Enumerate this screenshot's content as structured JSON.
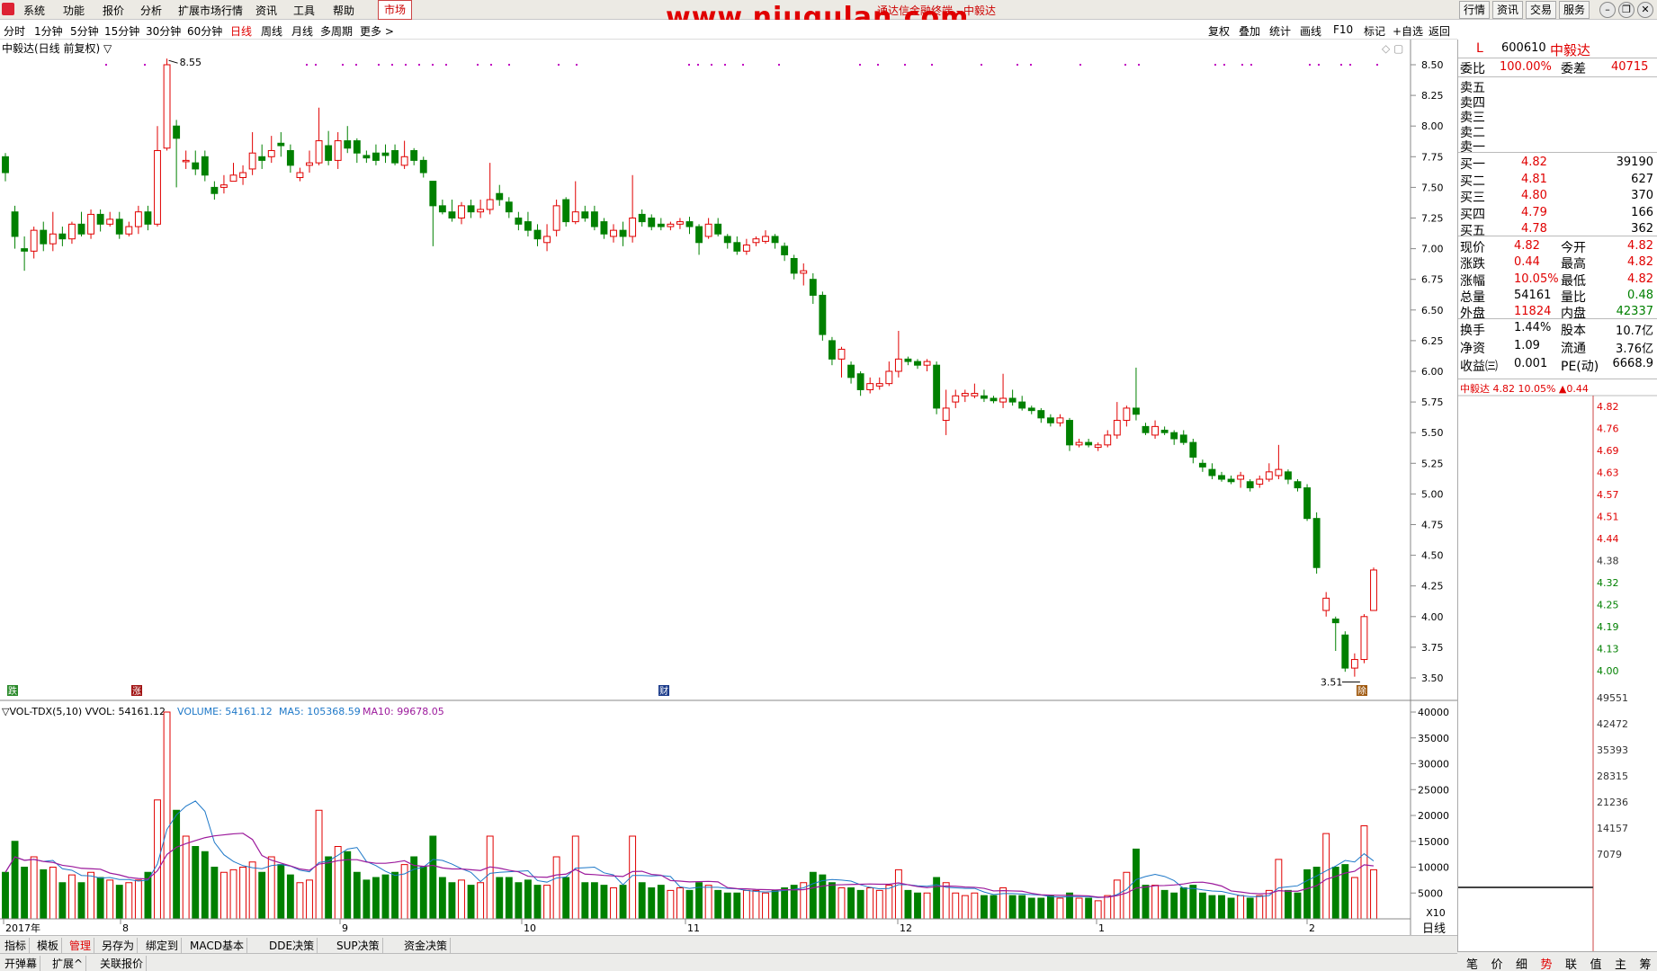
{
  "menu": {
    "items": [
      "系统",
      "功能",
      "报价",
      "分析",
      "扩展市场行情",
      "资讯",
      "工具",
      "帮助"
    ],
    "market_tab": "市场",
    "title": "通达信金融终端 - 中毅达",
    "right_buttons": [
      "行情",
      "资讯",
      "交易",
      "服务"
    ]
  },
  "watermark": "www.niugulan.com",
  "periods": [
    "分时",
    "1分钟",
    "5分钟",
    "15分钟",
    "30分钟",
    "60分钟",
    "日线",
    "周线",
    "月线",
    "多周期",
    "更多 >"
  ],
  "toolbar": [
    "复权",
    "叠加",
    "统计",
    "画线",
    "F10",
    "标记",
    "+自选",
    "返回"
  ],
  "chart_title": "中毅达(日线 前复权) ▽",
  "chart_data": {
    "type": "candlestick",
    "y_ticks": [
      "8.50",
      "8.25",
      "8.00",
      "7.75",
      "7.50",
      "7.25",
      "7.00",
      "6.75",
      "6.50",
      "6.25",
      "6.00",
      "5.75",
      "5.50",
      "5.25",
      "5.00",
      "4.75",
      "4.50",
      "4.25",
      "4.00",
      "3.75",
      "3.50"
    ],
    "high_label": "8.55",
    "low_label": "3.51",
    "x_labels": [
      "2017年",
      "8",
      "9",
      "10",
      "11",
      "12",
      "1",
      "2"
    ],
    "markers": [
      "跌",
      "涨",
      "财",
      "除"
    ],
    "candles": [
      [
        7.75,
        7.62,
        7.78,
        7.55
      ],
      [
        7.3,
        7.1,
        7.35,
        7.0
      ],
      [
        7.0,
        6.98,
        7.1,
        6.82
      ],
      [
        6.98,
        7.15,
        7.18,
        6.92
      ],
      [
        7.15,
        7.04,
        7.22,
        6.98
      ],
      [
        7.04,
        7.12,
        7.3,
        6.98
      ],
      [
        7.12,
        7.08,
        7.18,
        7.02
      ],
      [
        7.08,
        7.2,
        7.22,
        7.04
      ],
      [
        7.2,
        7.12,
        7.3,
        7.1
      ],
      [
        7.12,
        7.28,
        7.32,
        7.08
      ],
      [
        7.28,
        7.2,
        7.32,
        7.14
      ],
      [
        7.2,
        7.24,
        7.3,
        7.18
      ],
      [
        7.24,
        7.12,
        7.3,
        7.08
      ],
      [
        7.12,
        7.18,
        7.22,
        7.1
      ],
      [
        7.18,
        7.3,
        7.35,
        7.12
      ],
      [
        7.3,
        7.2,
        7.35,
        7.15
      ],
      [
        7.2,
        7.8,
        8.0,
        7.18
      ],
      [
        7.82,
        8.5,
        8.55,
        7.8
      ],
      [
        8.0,
        7.9,
        8.05,
        7.5
      ],
      [
        7.72,
        7.72,
        7.8,
        7.65
      ],
      [
        7.7,
        7.65,
        7.8,
        7.6
      ],
      [
        7.75,
        7.6,
        7.8,
        7.55
      ],
      [
        7.5,
        7.45,
        7.55,
        7.4
      ],
      [
        7.5,
        7.52,
        7.6,
        7.45
      ],
      [
        7.55,
        7.6,
        7.7,
        7.55
      ],
      [
        7.58,
        7.62,
        7.68,
        7.52
      ],
      [
        7.65,
        7.78,
        7.95,
        7.6
      ],
      [
        7.75,
        7.72,
        7.85,
        7.65
      ],
      [
        7.75,
        7.8,
        7.92,
        7.7
      ],
      [
        7.86,
        7.84,
        7.95,
        7.75
      ],
      [
        7.8,
        7.68,
        7.85,
        7.62
      ],
      [
        7.58,
        7.62,
        7.66,
        7.55
      ],
      [
        7.68,
        7.7,
        7.8,
        7.62
      ],
      [
        7.7,
        7.88,
        8.15,
        7.68
      ],
      [
        7.84,
        7.72,
        7.96,
        7.68
      ],
      [
        7.72,
        7.88,
        7.95,
        7.65
      ],
      [
        7.88,
        7.82,
        8.0,
        7.78
      ],
      [
        7.88,
        7.78,
        7.9,
        7.7
      ],
      [
        7.76,
        7.74,
        7.8,
        7.7
      ],
      [
        7.78,
        7.72,
        7.85,
        7.68
      ],
      [
        7.78,
        7.76,
        7.85,
        7.7
      ],
      [
        7.8,
        7.7,
        7.85,
        7.68
      ],
      [
        7.68,
        7.75,
        7.88,
        7.65
      ],
      [
        7.8,
        7.72,
        7.82,
        7.68
      ],
      [
        7.72,
        7.62,
        7.75,
        7.58
      ],
      [
        7.55,
        7.35,
        7.55,
        7.02
      ],
      [
        7.35,
        7.3,
        7.4,
        7.28
      ],
      [
        7.3,
        7.25,
        7.4,
        7.22
      ],
      [
        7.25,
        7.35,
        7.38,
        7.2
      ],
      [
        7.35,
        7.3,
        7.4,
        7.25
      ],
      [
        7.3,
        7.32,
        7.4,
        7.25
      ],
      [
        7.32,
        7.4,
        7.7,
        7.28
      ],
      [
        7.45,
        7.4,
        7.52,
        7.35
      ],
      [
        7.38,
        7.3,
        7.42,
        7.25
      ],
      [
        7.25,
        7.2,
        7.3,
        7.15
      ],
      [
        7.22,
        7.15,
        7.3,
        7.1
      ],
      [
        7.15,
        7.08,
        7.2,
        7.02
      ],
      [
        7.05,
        7.1,
        7.2,
        6.98
      ],
      [
        7.15,
        7.35,
        7.4,
        7.1
      ],
      [
        7.4,
        7.22,
        7.42,
        7.18
      ],
      [
        7.22,
        7.3,
        7.55,
        7.2
      ],
      [
        7.3,
        7.25,
        7.35,
        7.22
      ],
      [
        7.3,
        7.18,
        7.35,
        7.15
      ],
      [
        7.22,
        7.12,
        7.25,
        7.08
      ],
      [
        7.1,
        7.15,
        7.2,
        7.05
      ],
      [
        7.15,
        7.1,
        7.22,
        7.02
      ],
      [
        7.1,
        7.25,
        7.6,
        7.05
      ],
      [
        7.28,
        7.22,
        7.32,
        7.18
      ],
      [
        7.25,
        7.18,
        7.28,
        7.15
      ],
      [
        7.2,
        7.18,
        7.25,
        7.15
      ],
      [
        7.18,
        7.2,
        7.22,
        7.15
      ],
      [
        7.2,
        7.22,
        7.25,
        7.16
      ],
      [
        7.22,
        7.18,
        7.26,
        7.12
      ],
      [
        7.18,
        7.05,
        7.2,
        6.95
      ],
      [
        7.1,
        7.2,
        7.25,
        7.08
      ],
      [
        7.2,
        7.12,
        7.25,
        7.1
      ],
      [
        7.1,
        7.05,
        7.12,
        7.0
      ],
      [
        7.05,
        6.98,
        7.1,
        6.95
      ],
      [
        6.98,
        7.03,
        7.08,
        6.95
      ],
      [
        7.05,
        7.08,
        7.1,
        7.02
      ],
      [
        7.06,
        7.1,
        7.15,
        7.04
      ],
      [
        7.1,
        7.05,
        7.12,
        7.0
      ],
      [
        7.02,
        6.95,
        7.05,
        6.9
      ],
      [
        6.92,
        6.8,
        6.95,
        6.75
      ],
      [
        6.8,
        6.82,
        6.88,
        6.7
      ],
      [
        6.75,
        6.62,
        6.8,
        6.55
      ],
      [
        6.62,
        6.3,
        6.65,
        6.25
      ],
      [
        6.25,
        6.1,
        6.28,
        6.05
      ],
      [
        6.1,
        6.18,
        6.2,
        5.95
      ],
      [
        6.05,
        5.95,
        6.08,
        5.9
      ],
      [
        5.98,
        5.85,
        6.0,
        5.8
      ],
      [
        5.85,
        5.9,
        5.95,
        5.82
      ],
      [
        5.88,
        5.9,
        5.95,
        5.85
      ],
      [
        5.9,
        6.0,
        6.08,
        5.88
      ],
      [
        6.0,
        6.1,
        6.33,
        5.95
      ],
      [
        6.1,
        6.08,
        6.12,
        6.05
      ],
      [
        6.08,
        6.05,
        6.1,
        6.02
      ],
      [
        6.05,
        6.08,
        6.1,
        6.0
      ],
      [
        6.05,
        5.7,
        6.08,
        5.65
      ],
      [
        5.6,
        5.7,
        5.85,
        5.48
      ],
      [
        5.75,
        5.8,
        5.85,
        5.7
      ],
      [
        5.8,
        5.82,
        5.85,
        5.75
      ],
      [
        5.8,
        5.82,
        5.9,
        5.78
      ],
      [
        5.8,
        5.78,
        5.85,
        5.75
      ],
      [
        5.78,
        5.76,
        5.8,
        5.74
      ],
      [
        5.75,
        5.78,
        5.98,
        5.7
      ],
      [
        5.78,
        5.75,
        5.85,
        5.72
      ],
      [
        5.75,
        5.7,
        5.8,
        5.68
      ],
      [
        5.7,
        5.68,
        5.72,
        5.65
      ],
      [
        5.68,
        5.62,
        5.7,
        5.58
      ],
      [
        5.62,
        5.58,
        5.65,
        5.55
      ],
      [
        5.58,
        5.62,
        5.65,
        5.55
      ],
      [
        5.6,
        5.4,
        5.62,
        5.35
      ],
      [
        5.4,
        5.42,
        5.45,
        5.38
      ],
      [
        5.42,
        5.4,
        5.45,
        5.38
      ],
      [
        5.38,
        5.4,
        5.42,
        5.35
      ],
      [
        5.4,
        5.48,
        5.52,
        5.38
      ],
      [
        5.48,
        5.6,
        5.75,
        5.45
      ],
      [
        5.6,
        5.7,
        5.72,
        5.55
      ],
      [
        5.7,
        5.65,
        6.03,
        5.6
      ],
      [
        5.55,
        5.5,
        5.58,
        5.48
      ],
      [
        5.48,
        5.55,
        5.6,
        5.45
      ],
      [
        5.52,
        5.5,
        5.55,
        5.48
      ],
      [
        5.5,
        5.45,
        5.52,
        5.4
      ],
      [
        5.48,
        5.42,
        5.52,
        5.4
      ],
      [
        5.42,
        5.3,
        5.45,
        5.25
      ],
      [
        5.25,
        5.22,
        5.28,
        5.18
      ],
      [
        5.2,
        5.15,
        5.25,
        5.12
      ],
      [
        5.15,
        5.12,
        5.18,
        5.1
      ],
      [
        5.12,
        5.1,
        5.15,
        5.08
      ],
      [
        5.12,
        5.15,
        5.18,
        5.05
      ],
      [
        5.1,
        5.05,
        5.12,
        5.02
      ],
      [
        5.08,
        5.12,
        5.15,
        5.05
      ],
      [
        5.12,
        5.18,
        5.25,
        5.1
      ],
      [
        5.15,
        5.2,
        5.4,
        5.12
      ],
      [
        5.18,
        5.12,
        5.2,
        5.08
      ],
      [
        5.1,
        5.05,
        5.12,
        5.02
      ],
      [
        5.05,
        4.8,
        5.08,
        4.78
      ],
      [
        4.8,
        4.4,
        4.85,
        4.35
      ],
      [
        4.05,
        4.15,
        4.2,
        4.0
      ],
      [
        3.98,
        3.95,
        4.0,
        3.72
      ],
      [
        3.85,
        3.58,
        3.88,
        3.55
      ],
      [
        3.58,
        3.65,
        3.7,
        3.51
      ],
      [
        3.65,
        4.0,
        4.02,
        3.62
      ],
      [
        4.05,
        4.38,
        4.4,
        4.05
      ]
    ],
    "vol_ticks": [
      "40000",
      "35000",
      "30000",
      "25000",
      "20000",
      "15000",
      "10000",
      "5000"
    ],
    "vol_ticks_small": [
      "X10"
    ]
  },
  "vol_title": "▽VOL-TDX(5,10)  VVOL: 54161.12",
  "vol_volume": "VOLUME: 54161.12",
  "vol_ma5": "MA5: 105368.59",
  "vol_ma10": "MA10: 99678.05",
  "quote": {
    "code": "600610",
    "name": "中毅达",
    "flag": "L",
    "weibi_label": "委比",
    "weibi": "100.00%",
    "weicha_label": "委差",
    "weicha": "40715",
    "sells": [
      "卖五",
      "卖四",
      "卖三",
      "卖二",
      "卖一"
    ],
    "buys": [
      [
        "买一",
        "4.82",
        "39190"
      ],
      [
        "买二",
        "4.81",
        "627"
      ],
      [
        "买三",
        "4.80",
        "370"
      ],
      [
        "买四",
        "4.79",
        "166"
      ],
      [
        "买五",
        "4.78",
        "362"
      ]
    ],
    "stats": [
      [
        "现价",
        "4.82",
        "今开",
        "4.82"
      ],
      [
        "涨跌",
        "0.44",
        "最高",
        "4.82"
      ],
      [
        "涨幅",
        "10.05%",
        "最低",
        "4.82"
      ],
      [
        "总量",
        "54161",
        "量比",
        "0.48"
      ],
      [
        "外盘",
        "11824",
        "内盘",
        "42337"
      ]
    ],
    "stats2": [
      [
        "换手",
        "1.44%",
        "股本",
        "10.7亿"
      ],
      [
        "净资",
        "1.09",
        "流通",
        "3.76亿"
      ],
      [
        "收益㈢",
        "0.001",
        "PE(动)",
        "6668.9"
      ]
    ],
    "mini_header": "中毅达  4.82 10.05% ▲0.44",
    "mini_prices": [
      "4.82",
      "4.76",
      "4.69",
      "4.63",
      "4.57",
      "4.51",
      "4.44",
      "4.38",
      "4.32",
      "4.25",
      "4.19",
      "4.13",
      "4.00"
    ],
    "mini_vols": [
      "49551",
      "42472",
      "35393",
      "28315",
      "21236",
      "14157",
      "7079"
    ]
  },
  "bottom_tabs": [
    "指标",
    "模板",
    "管理",
    "另存为",
    "绑定到",
    "MACD基本",
    "DDE决策",
    "SUP决策",
    "资金决策"
  ],
  "bottom_tabs2": [
    "开弹幕",
    "扩展^",
    "关联报价"
  ],
  "daily_label": "日线",
  "right_bottom": [
    "笔",
    "价",
    "细",
    "势",
    "联",
    "值",
    "主",
    "筹"
  ]
}
